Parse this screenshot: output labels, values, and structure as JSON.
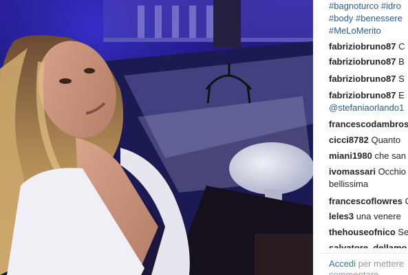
{
  "post": {
    "caption_tags": [
      "#bagnoturco #idro",
      "#body #benessere",
      "#MeLoMerito"
    ]
  },
  "comments": [
    {
      "user": "fabriziobruno87",
      "text": "C"
    },
    {
      "user": "fabriziobruno87",
      "text": "B"
    },
    {
      "user": "fabriziobruno87",
      "text": "S"
    },
    {
      "user": "fabriziobruno87",
      "text": "E",
      "mention": "@stefaniaorlando1"
    },
    {
      "user": "francescodambros",
      "text": ""
    },
    {
      "user": "cicci8782",
      "text": "Quanto"
    },
    {
      "user": "miani1980",
      "text": "che san"
    },
    {
      "user": "ivomassari",
      "text": "Occhio",
      "continuation": "bellissima"
    },
    {
      "user": "francescoflowres",
      "text": "C"
    },
    {
      "user": "leles3",
      "text": "una venere"
    },
    {
      "user": "thehouseofnico",
      "text": "Se"
    },
    {
      "user": "salvatore_dellamo",
      "text": ""
    }
  ],
  "login_prompt": {
    "link": "Accedi",
    "text": "per mettere",
    "text2": "commentare"
  },
  "colors": {
    "link": "#2d5c8e",
    "text": "#262626",
    "muted": "#999999",
    "photo_blue": "#2a1f9a"
  }
}
